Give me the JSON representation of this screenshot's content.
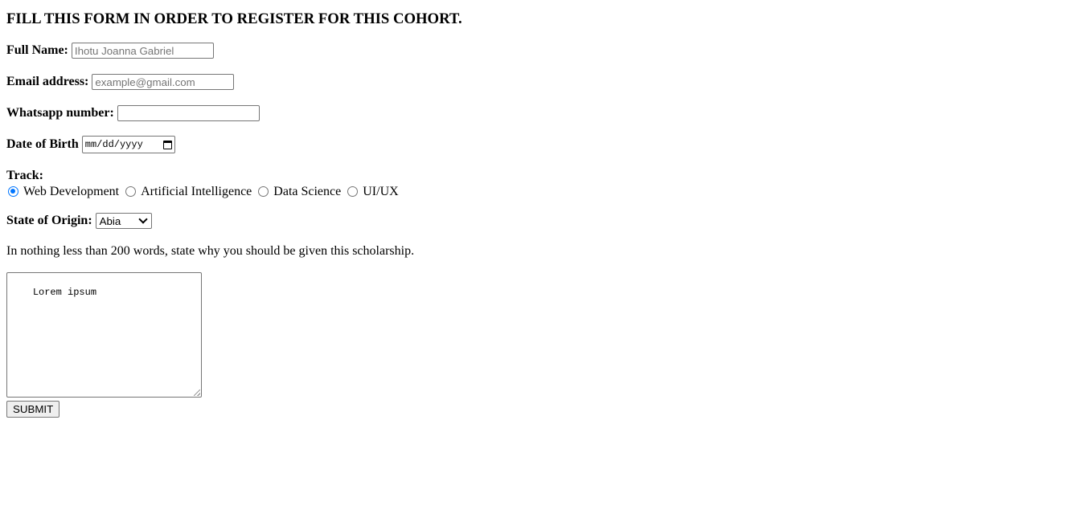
{
  "form": {
    "title": "FILL THIS FORM IN ORDER TO REGISTER FOR THIS COHORT.",
    "full_name": {
      "label": "Full Name:",
      "placeholder": "Ihotu Joanna Gabriel",
      "value": ""
    },
    "email": {
      "label": "Email address:",
      "placeholder": "example@gmail.com",
      "value": ""
    },
    "whatsapp": {
      "label": "Whatsapp number:",
      "placeholder": "",
      "value": ""
    },
    "dob": {
      "label": "Date of Birth",
      "placeholder": "mm/dd/yyyy",
      "icon": "calendar-icon"
    },
    "track": {
      "label": "Track:",
      "options": [
        {
          "label": "Web Development",
          "checked": true
        },
        {
          "label": "Artificial Intelligence",
          "checked": false
        },
        {
          "label": "Data Science",
          "checked": false
        },
        {
          "label": "UI/UX",
          "checked": false
        }
      ]
    },
    "state": {
      "label": "State of Origin:",
      "selected": "Abia",
      "icon": "chevron-down-icon"
    },
    "essay": {
      "prompt": "In nothing less than 200 words, state why you should be given this scholarship.",
      "value": "Lorem ipsum"
    },
    "submit_label": "SUBMIT"
  },
  "colors": {
    "radio_accent": "#0075ff",
    "border": "#767676",
    "button_bg": "#efefef",
    "placeholder": "#757575"
  }
}
